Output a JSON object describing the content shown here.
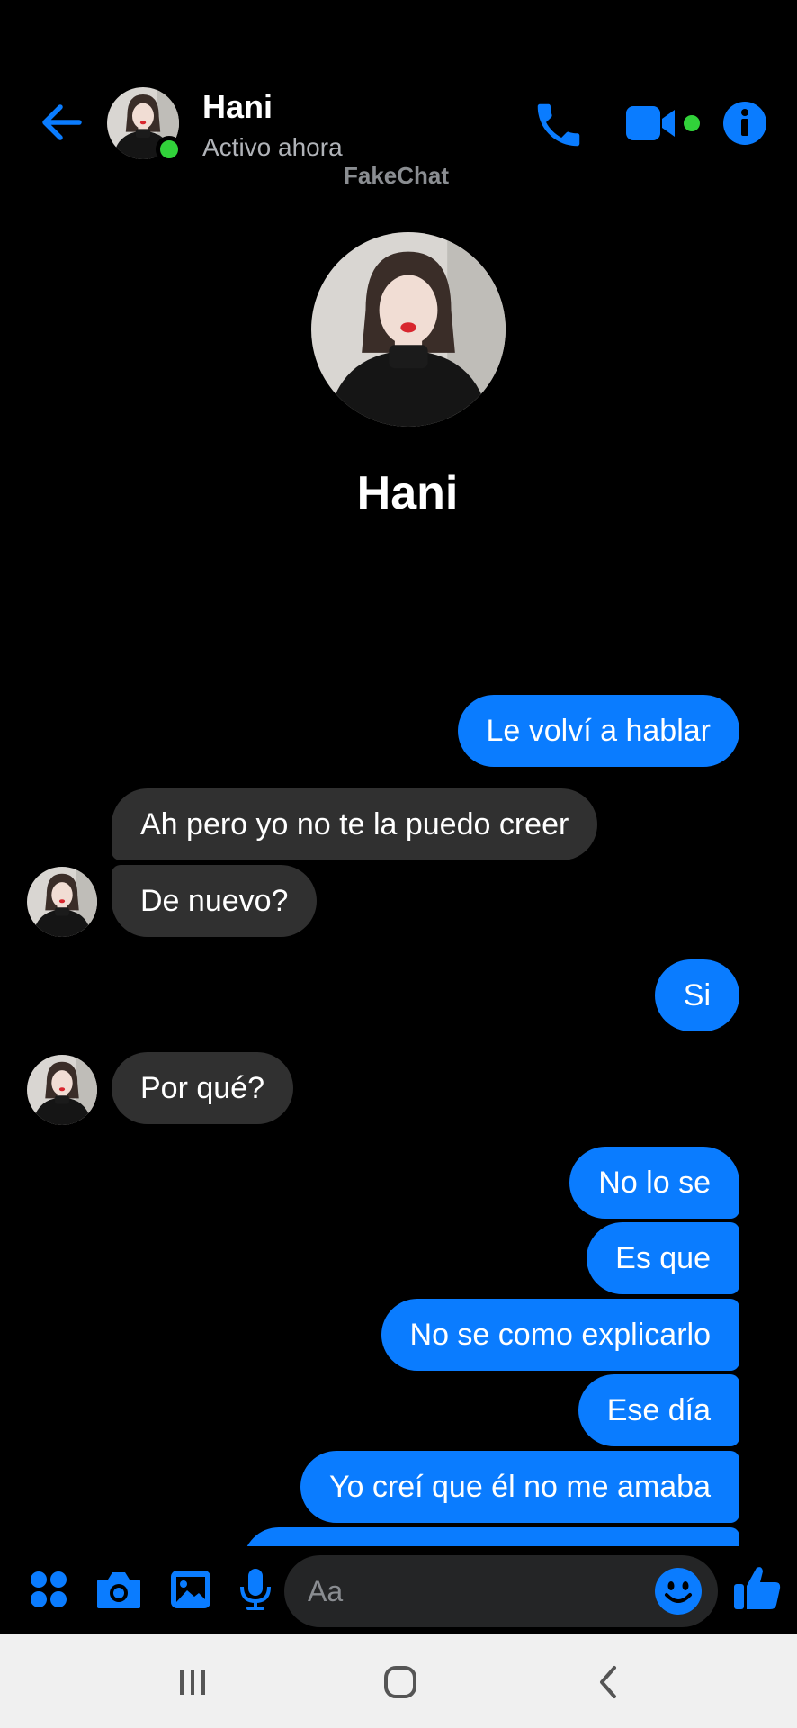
{
  "header": {
    "contact_name": "Hani",
    "status": "Activo ahora",
    "watermark": "FakeChat"
  },
  "profile": {
    "name": "Hani"
  },
  "messages": [
    {
      "sender": "me",
      "text": "Le volví a hablar"
    },
    {
      "sender": "them",
      "text": "Ah pero yo no te la puedo creer"
    },
    {
      "sender": "them",
      "text": "De nuevo?"
    },
    {
      "sender": "me",
      "text": "Si"
    },
    {
      "sender": "them",
      "text": "Por qué?"
    },
    {
      "sender": "me",
      "text": "No lo se"
    },
    {
      "sender": "me",
      "text": "Es que"
    },
    {
      "sender": "me",
      "text": "No se como explicarlo"
    },
    {
      "sender": "me",
      "text": "Ese día"
    },
    {
      "sender": "me",
      "text": "Yo creí que él no me amaba"
    }
  ],
  "composer": {
    "placeholder": "Aa"
  },
  "icons": {
    "back": "arrow-left-icon",
    "call": "phone-icon",
    "video": "video-camera-icon",
    "info": "info-icon",
    "menu": "four-dots-icon",
    "camera": "camera-icon",
    "gallery": "image-icon",
    "mic": "microphone-icon",
    "emoji": "smiley-icon",
    "like": "thumbs-up-icon"
  },
  "colors": {
    "accent": "#0a7cff",
    "online": "#31d23a",
    "them_bubble": "#303030",
    "background": "#000000"
  }
}
